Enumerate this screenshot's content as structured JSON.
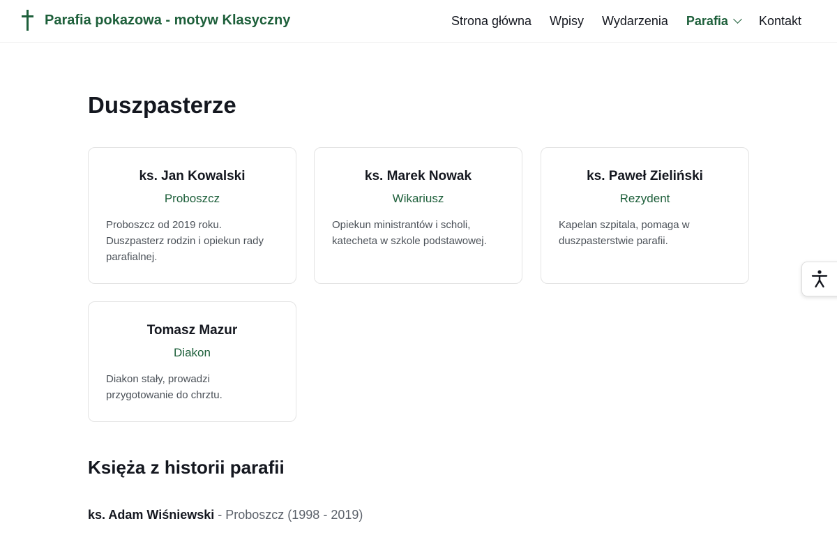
{
  "header": {
    "site_title": "Parafia pokazowa - motyw Klasyczny",
    "nav": [
      {
        "label": "Strona główna"
      },
      {
        "label": "Wpisy"
      },
      {
        "label": "Wydarzenia"
      },
      {
        "label": "Parafia",
        "active": true,
        "has_dropdown": true
      },
      {
        "label": "Kontakt"
      }
    ]
  },
  "main": {
    "title": "Duszpasterze",
    "clergy": [
      {
        "name": "ks. Jan Kowalski",
        "role": "Proboszcz",
        "description": "Proboszcz od 2019 roku. Duszpasterz rodzin i opiekun rady parafialnej."
      },
      {
        "name": "ks. Marek Nowak",
        "role": "Wikariusz",
        "description": "Opiekun ministrantów i scholi, katecheta w szkole podstawowej."
      },
      {
        "name": "ks. Paweł Zieliński",
        "role": "Rezydent",
        "description": "Kapelan szpitala, pomaga w duszpasterstwie parafii."
      },
      {
        "name": "Tomasz Mazur",
        "role": "Diakon",
        "description": "Diakon stały, prowadzi przygotowanie do chrztu."
      }
    ],
    "history_title": "Księża z historii parafii",
    "history": [
      {
        "name": "ks. Adam Wiśniewski",
        "separator": " - ",
        "role": "Proboszcz (1998 - 2019)"
      }
    ]
  },
  "icons": {
    "logo": "cross-icon",
    "dropdown": "chevron-down-icon",
    "accessibility": "accessibility-icon"
  },
  "colors": {
    "accent": "#1d5f3a",
    "text": "#14171f",
    "muted": "#4b5158",
    "border": "#e3e3e3"
  }
}
